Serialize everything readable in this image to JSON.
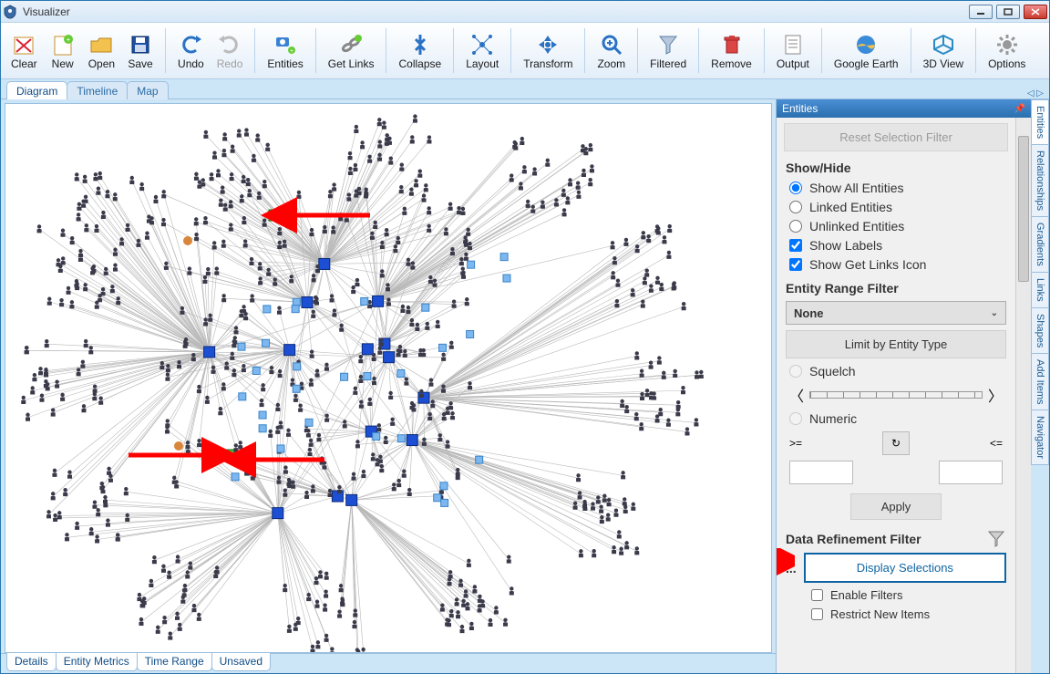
{
  "window": {
    "title": "Visualizer"
  },
  "toolbar": [
    {
      "id": "clear",
      "label": "Clear"
    },
    {
      "id": "new",
      "label": "New"
    },
    {
      "id": "open",
      "label": "Open"
    },
    {
      "id": "save",
      "label": "Save"
    },
    {
      "sep": true
    },
    {
      "id": "undo",
      "label": "Undo"
    },
    {
      "id": "redo",
      "label": "Redo",
      "disabled": true
    },
    {
      "sep": true
    },
    {
      "id": "entities",
      "label": "Entities"
    },
    {
      "sep": true
    },
    {
      "id": "getlinks",
      "label": "Get Links"
    },
    {
      "sep": true
    },
    {
      "id": "collapse",
      "label": "Collapse"
    },
    {
      "sep": true
    },
    {
      "id": "layout",
      "label": "Layout"
    },
    {
      "sep": true
    },
    {
      "id": "transform",
      "label": "Transform"
    },
    {
      "sep": true
    },
    {
      "id": "zoom",
      "label": "Zoom"
    },
    {
      "sep": true
    },
    {
      "id": "filtered",
      "label": "Filtered"
    },
    {
      "sep": true
    },
    {
      "id": "remove",
      "label": "Remove"
    },
    {
      "sep": true
    },
    {
      "id": "output",
      "label": "Output"
    },
    {
      "sep": true
    },
    {
      "id": "googleearth",
      "label": "Google Earth"
    },
    {
      "sep": true
    },
    {
      "id": "3dview",
      "label": "3D View"
    },
    {
      "sep": true
    },
    {
      "id": "options",
      "label": "Options"
    }
  ],
  "top_tabs": [
    {
      "label": "Diagram",
      "active": true
    },
    {
      "label": "Timeline",
      "active": false
    },
    {
      "label": "Map",
      "active": false
    }
  ],
  "bottom_tabs": [
    "Details",
    "Entity Metrics",
    "Time Range",
    "Unsaved"
  ],
  "side": {
    "header": "Entities",
    "reset_btn": "Reset Selection Filter",
    "showhide": {
      "title": "Show/Hide",
      "radios": [
        {
          "label": "Show All Entities",
          "checked": true
        },
        {
          "label": "Linked Entities",
          "checked": false
        },
        {
          "label": "Unlinked Entities",
          "checked": false
        }
      ],
      "checks": [
        {
          "label": "Show Labels",
          "checked": true
        },
        {
          "label": "Show Get Links Icon",
          "checked": true
        }
      ]
    },
    "range": {
      "title": "Entity Range Filter",
      "combo_value": "None",
      "limit_btn": "Limit by Entity Type",
      "squelch_label": "Squelch",
      "numeric_label": "Numeric",
      "ge": ">=",
      "le": "<=",
      "apply": "Apply"
    },
    "refine": {
      "title": "Data Refinement Filter",
      "dots": "...",
      "display_btn": "Display Selections",
      "enable": "Enable Filters",
      "restrict": "Restrict New Items"
    }
  },
  "vert_tabs": [
    "Entities",
    "Relationships",
    "Gradients",
    "Links",
    "Shapes",
    "Add Items",
    "Navigator"
  ]
}
